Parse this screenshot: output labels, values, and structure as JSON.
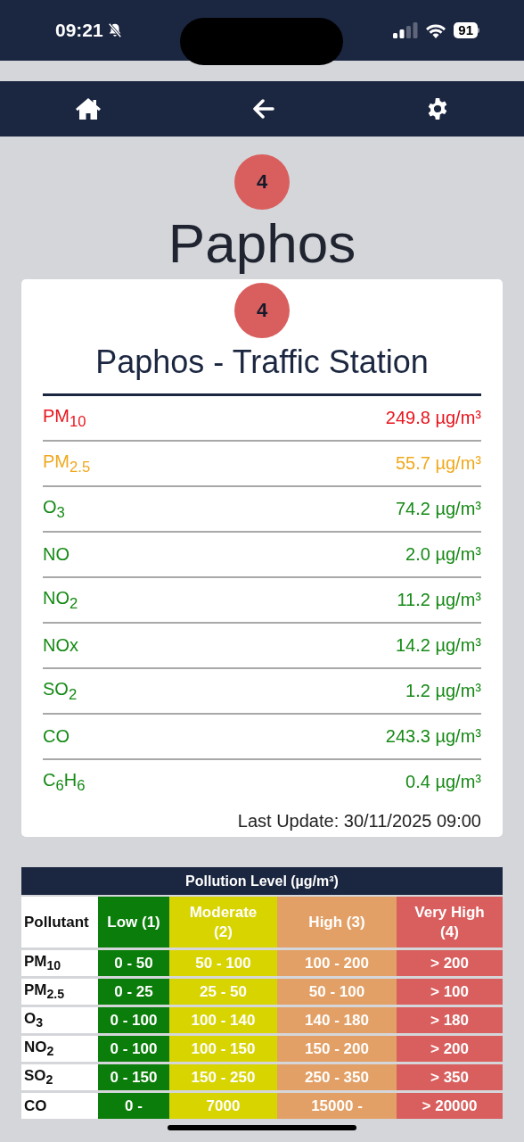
{
  "status_bar": {
    "time": "09:21",
    "battery": "91"
  },
  "city": {
    "index": "4",
    "name": "Paphos"
  },
  "station": {
    "index": "4",
    "name": "Paphos - Traffic Station",
    "readings": [
      {
        "pollutant": "PM$_{10}$",
        "value": "249.8 µg/m³",
        "color": "#e8141c"
      },
      {
        "pollutant": "PM$_{2.5}$",
        "value": "55.7 µg/m³",
        "color": "#f0a81c"
      },
      {
        "pollutant": "O$_{3}$",
        "value": "74.2 µg/m³",
        "color": "#168a16"
      },
      {
        "pollutant": "NO",
        "value": "2.0 µg/m³",
        "color": "#168a16"
      },
      {
        "pollutant": "NO$_{2}$",
        "value": "11.2 µg/m³",
        "color": "#168a16"
      },
      {
        "pollutant": "NOx",
        "value": "14.2 µg/m³",
        "color": "#168a16"
      },
      {
        "pollutant": "SO$_{2}$",
        "value": "1.2 µg/m³",
        "color": "#168a16"
      },
      {
        "pollutant": "CO",
        "value": "243.3 µg/m³",
        "color": "#168a16"
      },
      {
        "pollutant": "C$_{6}$H$_{6}$",
        "value": "0.4 µg/m³",
        "color": "#168a16"
      }
    ],
    "last_update": "Last Update: 30/11/2025 09:00"
  },
  "pollution_table": {
    "title": "Pollution Level (µg/m³)",
    "columns": [
      {
        "label": "Pollutant"
      },
      {
        "label": "Low (1)",
        "color": "#0a7d0a"
      },
      {
        "label": "Moderate (2)",
        "color": "#d8d400"
      },
      {
        "label": "High (3)",
        "color": "#e3a066"
      },
      {
        "label": "Very High (4)",
        "color": "#d95f5e"
      }
    ],
    "rows": [
      {
        "cells": [
          "PM$_{10}$",
          "0 - 50",
          "50 - 100",
          "100 - 200",
          "> 200"
        ]
      },
      {
        "cells": [
          "PM$_{2.5}$",
          "0 - 25",
          "25 - 50",
          "50 - 100",
          "> 100"
        ]
      },
      {
        "cells": [
          "O$_{3}$",
          "0 - 100",
          "100 - 140",
          "140 - 180",
          "> 180"
        ]
      },
      {
        "cells": [
          "NO$_{2}$",
          "0 - 100",
          "100 - 150",
          "150 - 200",
          "> 200"
        ]
      },
      {
        "cells": [
          "SO$_{2}$",
          "0 - 150",
          "150 - 250",
          "250 - 350",
          "> 350"
        ]
      },
      {
        "cells": [
          "CO",
          "0 -",
          "7000",
          "15000 -",
          "> 20000"
        ]
      }
    ]
  }
}
